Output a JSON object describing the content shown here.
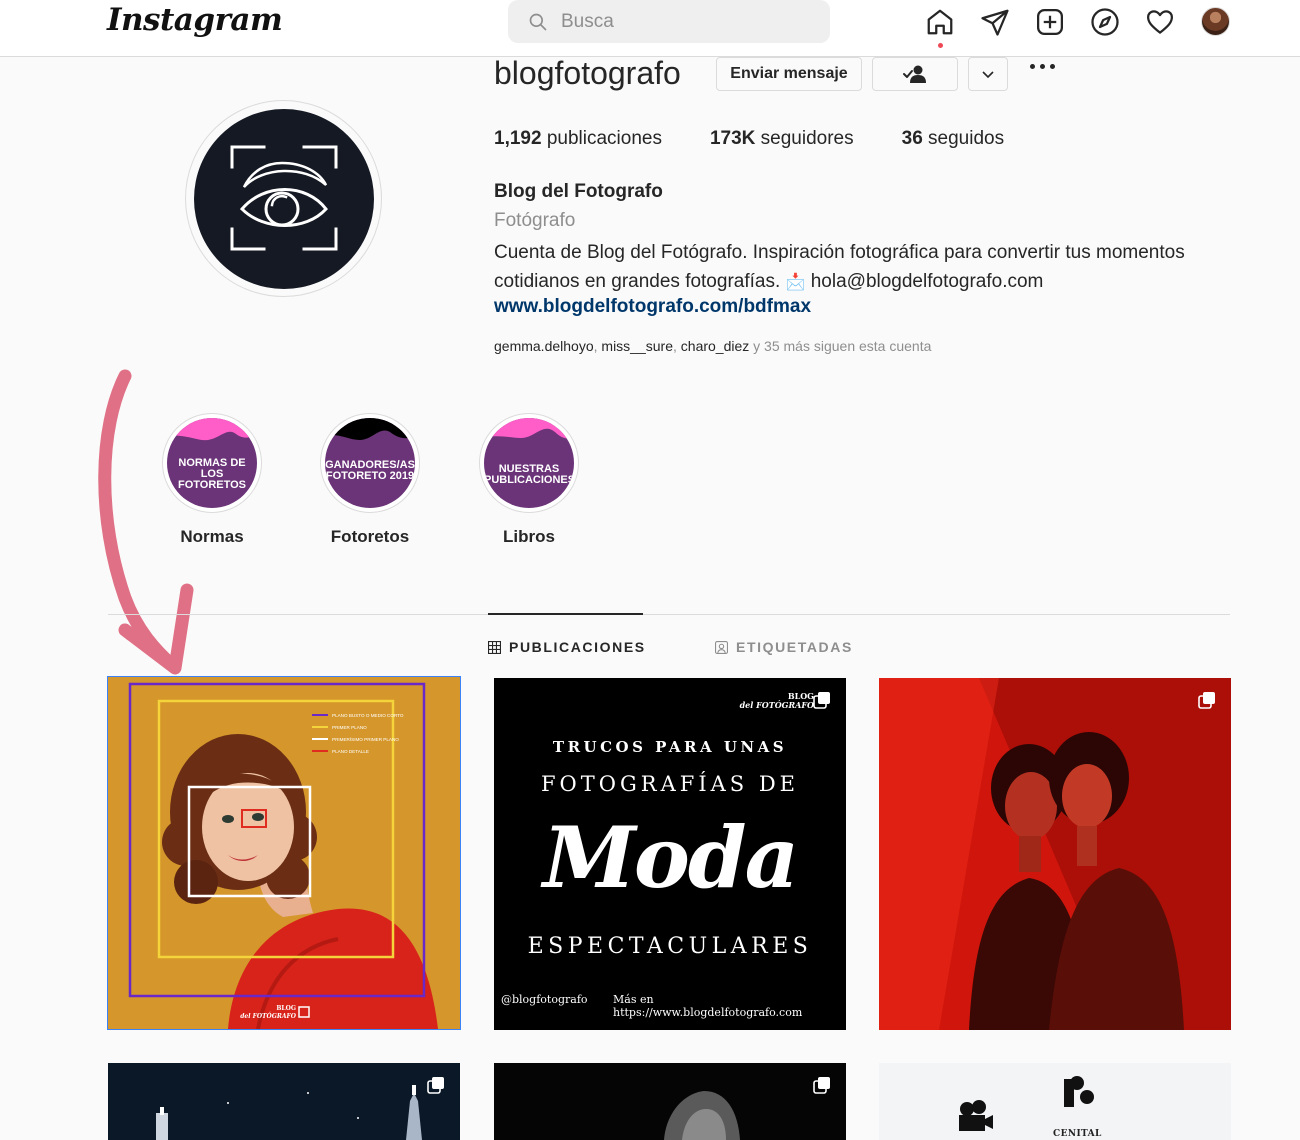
{
  "nav": {
    "logo": "Instagram",
    "search_placeholder": "Busca",
    "icons": [
      "home-icon",
      "direct-icon",
      "new-post-icon",
      "explore-icon",
      "activity-icon",
      "profile-avatar"
    ]
  },
  "profile": {
    "username": "blogfotografo",
    "buttons": {
      "message": "Enviar mensaje",
      "following": "person-check-icon",
      "dropdown": "chevron-down-icon",
      "more": "more-icon"
    },
    "stats": [
      {
        "value": "1,192",
        "label": "publicaciones"
      },
      {
        "value": "173K",
        "label": "seguidores"
      },
      {
        "value": "36",
        "label": "seguidos"
      }
    ],
    "full_name": "Blog del Fotografo",
    "category": "Fotógrafo",
    "bio_line1": "Cuenta de Blog del Fotógrafo. Inspiración fotográfica para convertir tus momentos",
    "bio_line2_pre": "cotidianos en grandes fotografías. ",
    "bio_emoji": "📩",
    "bio_line2_post": " hola@blogdelfotografo.com",
    "link": "www.blogdelfotografo.com/bdfmax",
    "followed_by": {
      "user1": "gemma.delhoyo",
      "user2": "miss__sure",
      "user3": "charo_diez",
      "rest": " y 35 más siguen esta cuenta"
    }
  },
  "highlights": [
    {
      "cover_line1": "NORMAS DE LOS",
      "cover_line2": "FOTORETOS",
      "label": "Normas"
    },
    {
      "cover_line1": "GANADORES/AS",
      "cover_line2": "FOTORETO 2019",
      "label": "Fotoretos"
    },
    {
      "cover_line1": "NUESTRAS",
      "cover_line2": "PUBLICACIONES",
      "label": "Libros"
    }
  ],
  "tabs": {
    "posts": "PUBLICACIONES",
    "tagged": "ETIQUETADAS"
  },
  "posts": {
    "p1": {
      "legend": [
        "PLANO BUSTO O MEDIO CORTO",
        "PRIMER PLANO",
        "PRIMERÍSIMO PRIMER PLANO",
        "PLANO DETALLE"
      ],
      "brand1": "BLOG",
      "brand2": "del FOTÓGRAFO"
    },
    "p2": {
      "brand1": "BLOG",
      "brand2": "del FOTÓGRAFO",
      "line1": "TRUCOS PARA UNAS",
      "line2": "FOTOGRAFÍAS DE",
      "script": "Moda",
      "line3": "ESPECTACULARES",
      "handle": "@blogfotografo",
      "url": "Más en https://www.blogdelfotografo.com"
    },
    "p6": {
      "label": "CENITAL"
    }
  },
  "colors": {
    "accent": "#00376b",
    "arrow": "#e07085",
    "highlight_bg": "#6b3478",
    "highlight_pink": "#ff5ec8"
  }
}
